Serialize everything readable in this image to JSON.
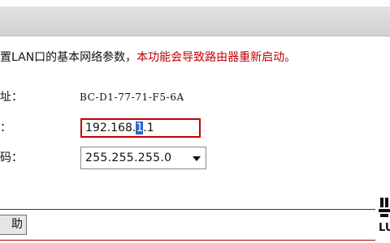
{
  "page": {
    "description_text": "置LAN口的基本网络参数，",
    "description_warning": "本功能会导致路由器重新启动。"
  },
  "form": {
    "mac_label": "址：",
    "mac_value": "BC-D1-77-71-F5-6A",
    "ip_label": "：",
    "ip_value_before": "192.168.",
    "ip_value_selected": "1",
    "ip_value_after": ".1",
    "mask_label": "码：",
    "mask_value": "255.255.255.0"
  },
  "footer": {
    "help_label": "助"
  },
  "brand": {
    "logo_text": "LU"
  },
  "colors": {
    "warning": "#c00000",
    "divider": "#b40000",
    "input_border": "#c40000",
    "selection": "#3366cc"
  },
  "icons": {
    "dropdown": "chevron-down-icon"
  }
}
